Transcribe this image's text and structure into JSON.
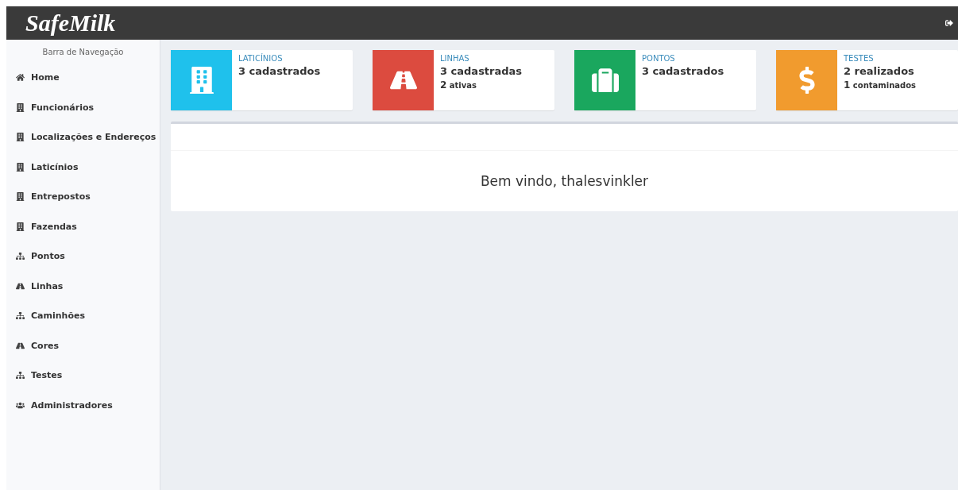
{
  "header": {
    "logo": "SafeMilk"
  },
  "sidebar": {
    "title": "Barra de Navegação",
    "items": [
      {
        "label": "Home",
        "kind": "home"
      },
      {
        "label": "Funcionários",
        "kind": "building"
      },
      {
        "label": "Localizações e Endereços",
        "kind": "building"
      },
      {
        "label": "Laticínios",
        "kind": "building"
      },
      {
        "label": "Entrepostos",
        "kind": "building"
      },
      {
        "label": "Fazendas",
        "kind": "building"
      },
      {
        "label": "Pontos",
        "kind": "sitemap"
      },
      {
        "label": "Linhas",
        "kind": "road"
      },
      {
        "label": "Caminhões",
        "kind": "sitemap"
      },
      {
        "label": "Cores",
        "kind": "road"
      },
      {
        "label": "Testes",
        "kind": "sitemap"
      },
      {
        "label": "Administradores",
        "kind": "users"
      }
    ]
  },
  "cards": [
    {
      "title": "LATICÍNIOS",
      "value": "3 cadastrados",
      "kind": "building",
      "color": "#1fc1ec"
    },
    {
      "title": "LINHAS",
      "value": "3 cadastradas",
      "detail": "**2** ativas",
      "kind": "road",
      "color": "#dc4b3f"
    },
    {
      "title": "PONTOS",
      "value": "3 cadastrados",
      "kind": "suitcase",
      "color": "#1aa75e"
    },
    {
      "title": "TESTES",
      "value": "2 realizados",
      "detail": "**1** contaminados",
      "kind": "dollar",
      "color": "#f19b2e"
    }
  ],
  "welcome": "Bem vindo, thalesvinkler"
}
